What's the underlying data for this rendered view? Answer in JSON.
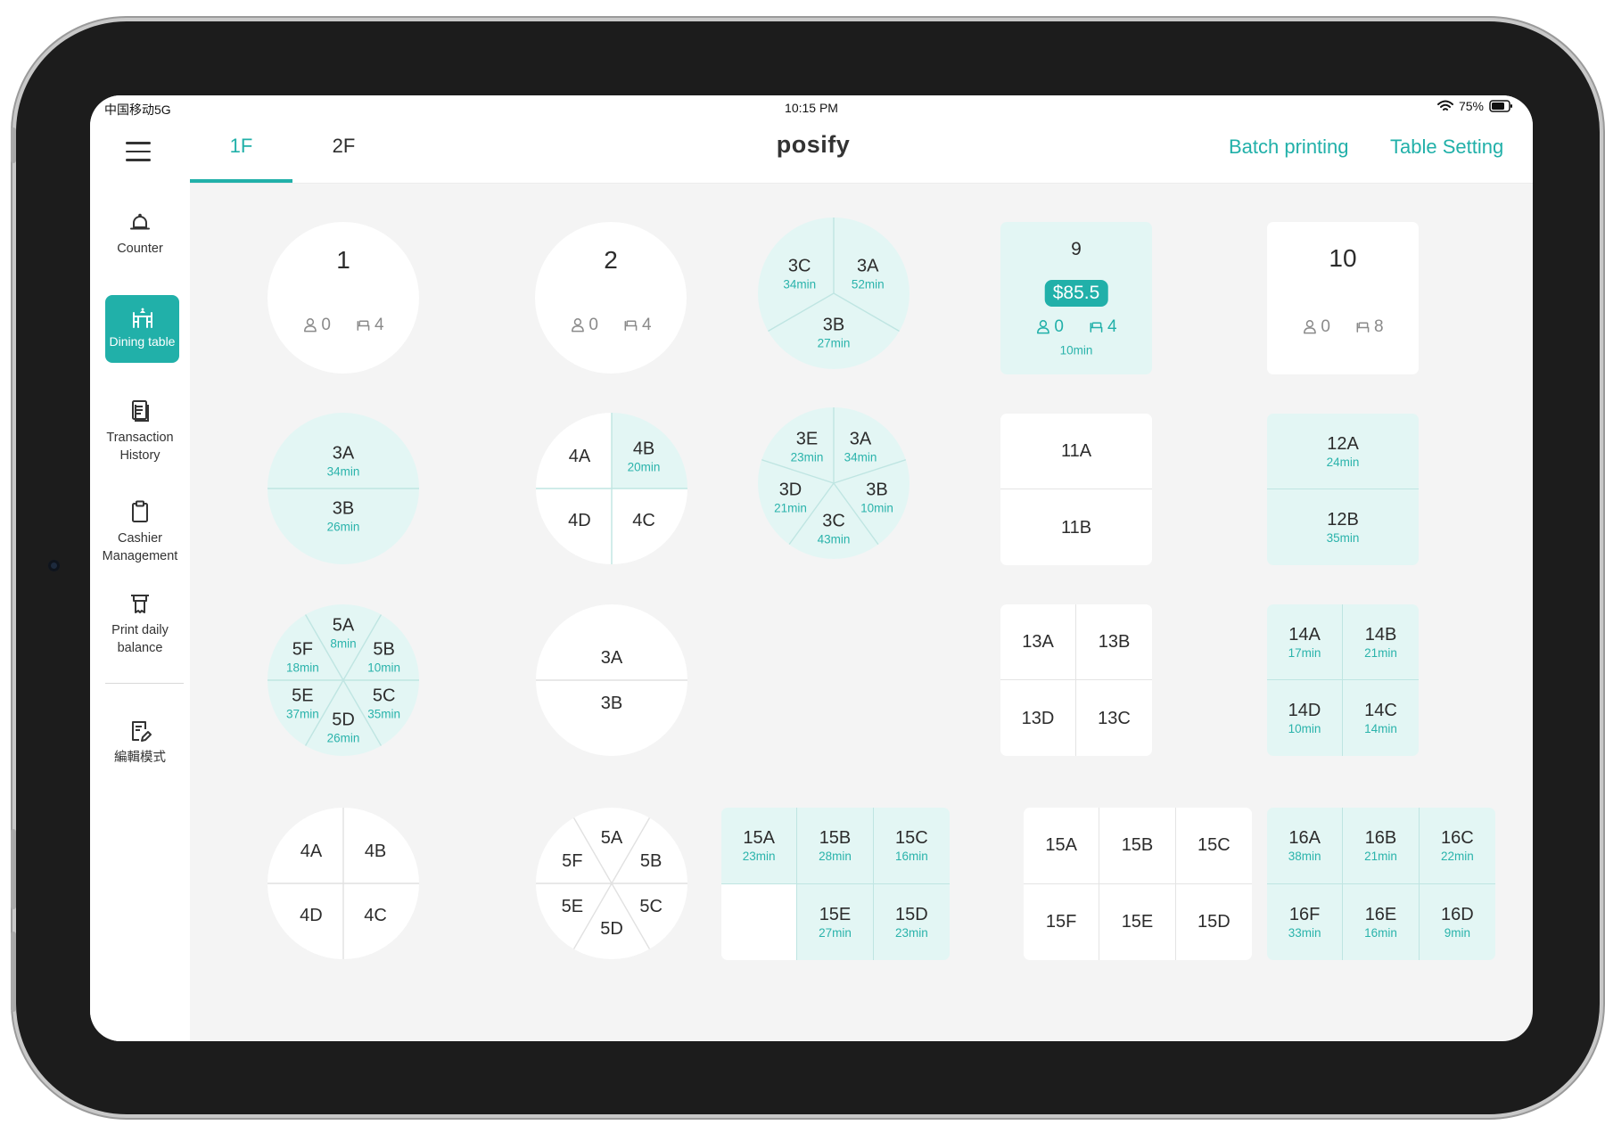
{
  "status_bar": {
    "carrier": "中国移动5G",
    "time": "10:15 PM",
    "battery": "75%"
  },
  "header": {
    "tabs": [
      {
        "label": "1F",
        "active": true
      },
      {
        "label": "2F",
        "active": false
      }
    ],
    "logo": "posify",
    "batch_printing": "Batch printing",
    "table_setting": "Table Setting"
  },
  "sidebar": {
    "menu_icon": "hamburger-menu-icon",
    "items": [
      {
        "label": "Counter",
        "icon": "bell-icon"
      },
      {
        "label": "Dining table",
        "icon": "dining-table-icon",
        "active": true
      },
      {
        "label": "Transaction History",
        "icon": "document-icon"
      },
      {
        "label": "Cashier Management",
        "icon": "clipboard-icon"
      },
      {
        "label": "Print daily balance",
        "icon": "printer-icon"
      },
      {
        "label": "編輯模式",
        "icon": "edit-icon"
      }
    ]
  },
  "colors": {
    "accent": "#21b0a9",
    "busy_fill": "#e3f6f4",
    "time_text": "#2ab3ab",
    "floor_bg": "#f4f4f4"
  },
  "tables": [
    {
      "name": "1",
      "shape": "round",
      "busy": false,
      "guests": "0",
      "seats": "4"
    },
    {
      "name": "2",
      "shape": "round",
      "busy": false,
      "guests": "0",
      "seats": "4"
    },
    {
      "shape": "round",
      "sections": [
        {
          "label": "3A",
          "time": "52min",
          "busy": true
        },
        {
          "label": "3B",
          "time": "27min",
          "busy": true
        },
        {
          "label": "3C",
          "time": "34min",
          "busy": true
        }
      ]
    },
    {
      "name": "9",
      "shape": "square",
      "busy": true,
      "amount": "$85.5",
      "guests": "0",
      "seats": "4",
      "time": "10min"
    },
    {
      "name": "10",
      "shape": "square",
      "busy": false,
      "guests": "0",
      "seats": "8"
    },
    {
      "shape": "round",
      "sections": [
        {
          "label": "3A",
          "time": "34min",
          "busy": true
        },
        {
          "label": "3B",
          "time": "26min",
          "busy": true
        }
      ]
    },
    {
      "shape": "round",
      "sections": [
        {
          "label": "4A",
          "busy": false
        },
        {
          "label": "4B",
          "time": "20min",
          "busy": true
        },
        {
          "label": "4C",
          "busy": false
        },
        {
          "label": "4D",
          "busy": false
        }
      ]
    },
    {
      "shape": "round",
      "sections": [
        {
          "label": "3A",
          "time": "34min",
          "busy": true
        },
        {
          "label": "3B",
          "time": "10min",
          "busy": true
        },
        {
          "label": "3C",
          "time": "43min",
          "busy": true
        },
        {
          "label": "3D",
          "time": "21min",
          "busy": true
        },
        {
          "label": "3E",
          "time": "23min",
          "busy": true
        }
      ]
    },
    {
      "shape": "square",
      "sections": [
        {
          "label": "11A",
          "busy": false
        },
        {
          "label": "11B",
          "busy": false
        }
      ]
    },
    {
      "shape": "square",
      "sections": [
        {
          "label": "12A",
          "time": "24min",
          "busy": true
        },
        {
          "label": "12B",
          "time": "35min",
          "busy": true
        }
      ]
    },
    {
      "shape": "round",
      "sections": [
        {
          "label": "5A",
          "time": "8min",
          "busy": true
        },
        {
          "label": "5B",
          "time": "10min",
          "busy": true
        },
        {
          "label": "5C",
          "time": "35min",
          "busy": true
        },
        {
          "label": "5D",
          "time": "26min",
          "busy": true
        },
        {
          "label": "5E",
          "time": "37min",
          "busy": true
        },
        {
          "label": "5F",
          "time": "18min",
          "busy": true
        }
      ]
    },
    {
      "shape": "round",
      "sections": [
        {
          "label": "3A",
          "busy": false
        },
        {
          "label": "3B",
          "busy": false
        }
      ]
    },
    {
      "shape": "square",
      "sections": [
        {
          "label": "13A",
          "busy": false
        },
        {
          "label": "13B",
          "busy": false
        },
        {
          "label": "13D",
          "busy": false
        },
        {
          "label": "13C",
          "busy": false
        }
      ]
    },
    {
      "shape": "square",
      "sections": [
        {
          "label": "14A",
          "time": "17min",
          "busy": true
        },
        {
          "label": "14B",
          "time": "21min",
          "busy": true
        },
        {
          "label": "14D",
          "time": "10min",
          "busy": true
        },
        {
          "label": "14C",
          "time": "14min",
          "busy": true
        }
      ]
    },
    {
      "shape": "round",
      "sections": [
        {
          "label": "4A",
          "busy": false
        },
        {
          "label": "4B",
          "busy": false
        },
        {
          "label": "4C",
          "busy": false
        },
        {
          "label": "4D",
          "busy": false
        }
      ]
    },
    {
      "shape": "round",
      "sections": [
        {
          "label": "5A",
          "busy": false
        },
        {
          "label": "5B",
          "busy": false
        },
        {
          "label": "5C",
          "busy": false
        },
        {
          "label": "5D",
          "busy": false
        },
        {
          "label": "5E",
          "busy": false
        },
        {
          "label": "5F",
          "busy": false
        }
      ]
    },
    {
      "shape": "square",
      "sections": [
        {
          "label": "15A",
          "time": "23min",
          "busy": true
        },
        {
          "label": "15B",
          "time": "28min",
          "busy": true
        },
        {
          "label": "15C",
          "time": "16min",
          "busy": true
        },
        {
          "label": "",
          "busy": false
        },
        {
          "label": "15E",
          "time": "27min",
          "busy": true
        },
        {
          "label": "15D",
          "time": "23min",
          "busy": true
        }
      ]
    },
    {
      "shape": "square",
      "sections": [
        {
          "label": "15A",
          "busy": false
        },
        {
          "label": "15B",
          "busy": false
        },
        {
          "label": "15C",
          "busy": false
        },
        {
          "label": "15F",
          "busy": false
        },
        {
          "label": "15E",
          "busy": false
        },
        {
          "label": "15D",
          "busy": false
        }
      ]
    },
    {
      "shape": "square",
      "sections": [
        {
          "label": "16A",
          "time": "38min",
          "busy": true
        },
        {
          "label": "16B",
          "time": "21min",
          "busy": true
        },
        {
          "label": "16C",
          "time": "22min",
          "busy": true
        },
        {
          "label": "16F",
          "time": "33min",
          "busy": true
        },
        {
          "label": "16E",
          "time": "16min",
          "busy": true
        },
        {
          "label": "16D",
          "time": "9min",
          "busy": true
        }
      ]
    }
  ]
}
